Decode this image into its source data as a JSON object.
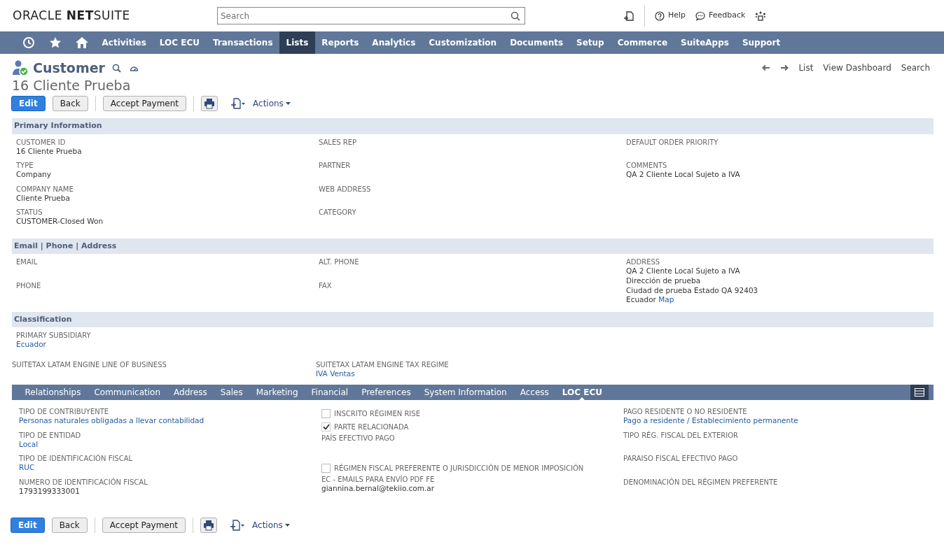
{
  "header": {
    "logo": "ORACLE **NET**SUITE",
    "search": {
      "placeholder": "Search"
    },
    "links": [
      "Help",
      "Feedback"
    ]
  },
  "nav": {
    "items": [
      {
        "label": "Activities",
        "selected": false
      },
      {
        "label": "LOC ECU",
        "selected": false
      },
      {
        "label": "Transactions",
        "selected": false
      },
      {
        "label": "Lists",
        "selected": true
      },
      {
        "label": "Reports",
        "selected": false
      },
      {
        "label": "Analytics",
        "selected": false
      },
      {
        "label": "Customization",
        "selected": false
      },
      {
        "label": "Documents",
        "selected": false
      },
      {
        "label": "Setup",
        "selected": false
      },
      {
        "label": "Commerce",
        "selected": false
      },
      {
        "label": "SuiteApps",
        "selected": false
      },
      {
        "label": "Support",
        "selected": false
      }
    ]
  },
  "page": {
    "type": "Customer",
    "record": "16 Cliente Prueba",
    "links": [
      "List",
      "View Dashboard",
      "Search"
    ]
  },
  "toolbar_top": {
    "buttons": [
      {
        "label": "Edit",
        "kind": "primary"
      },
      {
        "label": "Back",
        "kind": "default"
      },
      {
        "label": "Accept Payment",
        "kind": "default"
      }
    ],
    "actions": "Actions"
  },
  "sections": [
    {
      "title": "Primary Information",
      "columns": [
        [
          {
            "label": "CUSTOMER ID",
            "value": "16 Cliente Prueba"
          },
          {
            "label": "TYPE",
            "value": "Company"
          },
          {
            "label": "COMPANY NAME",
            "value": "Cliente Prueba"
          },
          {
            "label": "STATUS",
            "value": "CUSTOMER-Closed Won"
          }
        ],
        [
          {
            "label": "SALES REP"
          },
          {
            "label": "PARTNER"
          },
          {
            "label": "WEB ADDRESS"
          },
          {
            "label": "CATEGORY"
          }
        ],
        [
          {
            "label": "DEFAULT ORDER PRIORITY"
          },
          {
            "label": "COMMENTS",
            "value": "QA 2 Cliente Local Sujeto a IVA"
          }
        ]
      ]
    },
    {
      "title": "Email | Phone | Address",
      "columns": [
        [
          {
            "label": "EMAIL"
          },
          {
            "label": "PHONE"
          }
        ],
        [
          {
            "label": "ALT. PHONE"
          },
          {
            "label": "FAX"
          }
        ],
        [
          {
            "label": "ADDRESS",
            "lines": [
              "QA 2 Cliente Local Sujeto a IVA",
              "Dirección de prueba",
              "Ciudad de prueba Estado QA 92403",
              "Ecuador"
            ],
            "link_text": "Map"
          }
        ]
      ]
    },
    {
      "title": "Classification",
      "columns": [
        [
          {
            "label": "PRIMARY SUBSIDIARY",
            "value": "Ecuador",
            "link": true
          }
        ],
        [],
        []
      ],
      "extra": [
        {
          "label": "SUITETAX LATAM ENGINE LINE OF BUSINESS"
        },
        {
          "label": "SUITETAX LATAM ENGINE TAX REGIME",
          "value": "IVA Ventas",
          "link": true
        }
      ]
    }
  ],
  "tabs": [
    {
      "label": "Relationships",
      "selected": false
    },
    {
      "label": "Communication",
      "selected": false
    },
    {
      "label": "Address",
      "selected": false
    },
    {
      "label": "Sales",
      "selected": false
    },
    {
      "label": "Marketing",
      "selected": false
    },
    {
      "label": "Financial",
      "selected": false
    },
    {
      "label": "Preferences",
      "selected": false
    },
    {
      "label": "System Information",
      "selected": false
    },
    {
      "label": "Access",
      "selected": false
    },
    {
      "label": "LOC ECU",
      "selected": true
    }
  ],
  "tab_content": {
    "columns": [
      [
        {
          "kind": "text",
          "label": "TIPO DE CONTRIBUYENTE",
          "value": "Personas naturales obligadas a llevar contabilidad",
          "link": true
        },
        {
          "kind": "text",
          "label": "TIPO DE ENTIDAD",
          "value": "Local",
          "link": true
        },
        {
          "kind": "text",
          "label": "TIPO DE IDENTIFICACIÓN FISCAL",
          "value": "RUC",
          "link": true
        },
        {
          "kind": "text",
          "label": "NUMERO DE IDENTIFICACIÓN FISCAL",
          "value": "1793199333001"
        }
      ],
      [
        {
          "kind": "checkbox",
          "label": "INSCRITO RÉGIMEN RISE",
          "checked": false
        },
        {
          "kind": "checkbox",
          "label": "PARTE RELACIONADA",
          "checked": true
        },
        {
          "kind": "text",
          "label": "PAÍS EFECTIVO PAGO"
        },
        {
          "kind": "checkbox",
          "label": "RÉGIMEN FISCAL PREFERENTE O JURISDICCIÓN DE MENOR IMPOSICIÓN",
          "checked": false
        },
        {
          "kind": "text",
          "label": "EC - EMAILS PARA ENVÍO PDF FE",
          "value": "giannina.bernal@tekiio.com.ar"
        }
      ],
      [
        {
          "kind": "text",
          "label": "PAGO RESIDENTE O NO RESIDENTE",
          "value": "Pago a residente / Establecimiento permanente",
          "link": true
        },
        {
          "kind": "text",
          "label": "TIPO RÉG. FISCAL DEL EXTERIOR"
        },
        {
          "kind": "text",
          "label": "PARAISO FISCAL EFECTIVO PAGO"
        },
        {
          "kind": "text",
          "label": "DENOMINACIÓN DEL RÉGIMEN PREFERENTE"
        }
      ]
    ]
  },
  "toolbar_bottom": {
    "buttons": [
      {
        "label": "Edit",
        "kind": "primary"
      },
      {
        "label": "Back",
        "kind": "default"
      },
      {
        "label": "Accept Payment",
        "kind": "default"
      }
    ],
    "actions": "Actions"
  }
}
